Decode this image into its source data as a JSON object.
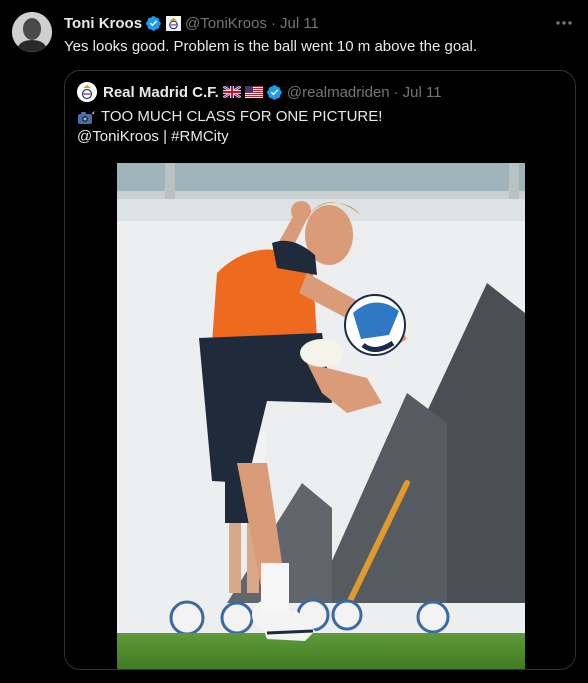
{
  "tweet": {
    "author_name": "Toni Kroos",
    "handle": "@ToniKroos",
    "separator": "·",
    "date": "Jul 11",
    "text": "Yes looks good. Problem is the ball went 10 m above the goal."
  },
  "quoted": {
    "author_name": "Real Madrid C.F.",
    "handle": "@realmadriden",
    "separator": "·",
    "date": "Jul 11",
    "line1": "TOO MUCH CLASS FOR ONE PICTURE!",
    "line2": "@ToniKroos | #RMCity",
    "flags": [
      "uk-flag",
      "us-flag"
    ]
  },
  "colors": {
    "background": "#000000",
    "text": "#e7e9ea",
    "muted": "#71767b",
    "verified": "#1d9bf0",
    "border": "#2f3336"
  },
  "icons": [
    "verified-badge-icon",
    "real-madrid-badge-icon",
    "more-options-icon",
    "camera-flash-icon"
  ]
}
